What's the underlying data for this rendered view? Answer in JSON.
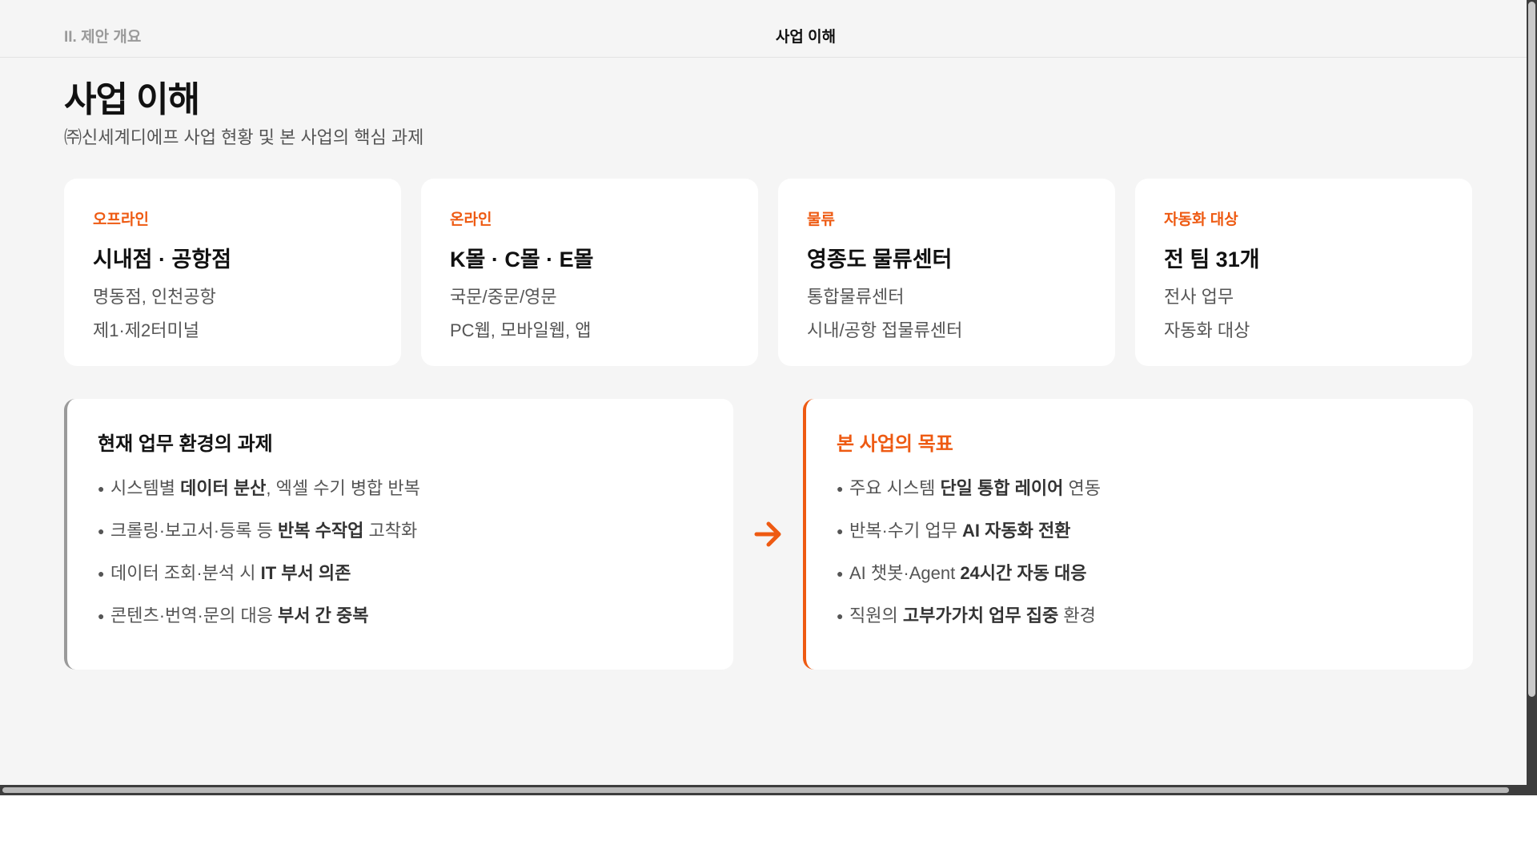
{
  "header": {
    "section_label": "II. 제안 개요",
    "title": "사업 이해"
  },
  "page": {
    "title": "사업 이해",
    "subtitle": "㈜신세계디에프 사업 현황 및 본 사업의 핵심 과제"
  },
  "stats": [
    {
      "category": "오프라인",
      "headline": "시내점 · 공항점",
      "line1": "명동점, 인천공항",
      "line2": "제1·제2터미널"
    },
    {
      "category": "온라인",
      "headline": "K몰 · C몰 · E몰",
      "line1": "국문/중문/영문",
      "line2": "PC웹, 모바일웹, 앱"
    },
    {
      "category": "물류",
      "headline": "영종도 물류센터",
      "line1": "통합물류센터",
      "line2": "시내/공항 접물류센터"
    },
    {
      "category": "자동화 대상",
      "headline": "전 팀 31개",
      "line1": "전사 업무",
      "line2": "자동화 대상"
    }
  ],
  "challenges": {
    "title": "현재 업무 환경의 과제",
    "items": [
      {
        "pre": "시스템별 ",
        "bold": "데이터 분산",
        "post": ", 엑셀 수기 병합 반복"
      },
      {
        "pre": "크롤링·보고서·등록 등 ",
        "bold": "반복 수작업",
        "post": " 고착화"
      },
      {
        "pre": "데이터 조회·분석 시 ",
        "bold": "IT 부서 의존",
        "post": ""
      },
      {
        "pre": "콘텐츠·번역·문의 대응 ",
        "bold": "부서 간 중복",
        "post": ""
      }
    ]
  },
  "goals": {
    "title": "본 사업의 목표",
    "items": [
      {
        "pre": "주요 시스템 ",
        "bold": "단일 통합 레이어",
        "post": " 연동"
      },
      {
        "pre": "반복·수기 업무 ",
        "bold": "AI 자동화 전환",
        "post": ""
      },
      {
        "pre": "AI 챗봇·Agent ",
        "bold": "24시간 자동 대응",
        "post": ""
      },
      {
        "pre": "직원의 ",
        "bold": "고부가가치 업무 집중",
        "post": " 환경"
      }
    ]
  },
  "colors": {
    "accent": "#ee5a12",
    "background": "#f5f5f5",
    "card": "#ffffff",
    "muted_border": "#9a9a9a"
  },
  "icons": {
    "transition": "arrow-right-icon",
    "bullet": "bullet-dot-icon"
  }
}
